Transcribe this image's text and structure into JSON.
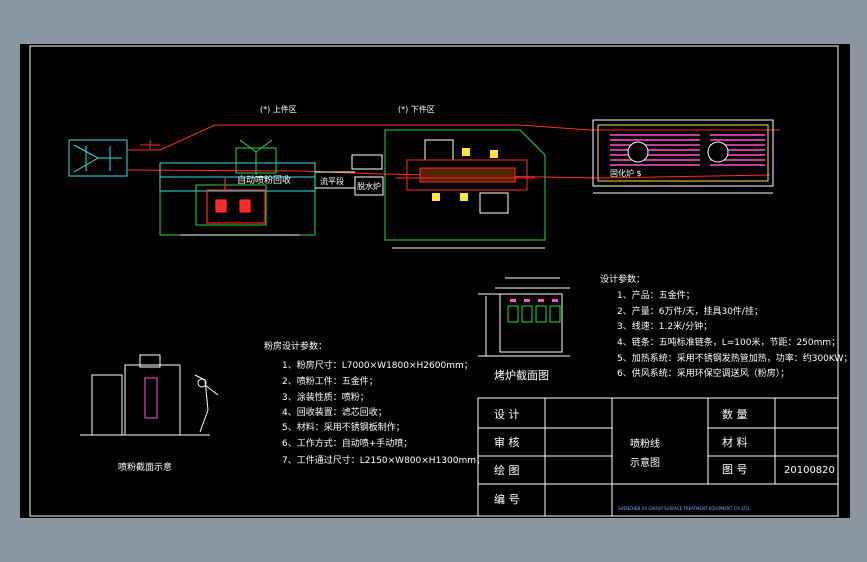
{
  "colors": {
    "background": "#8d97a3",
    "sheet": "#000000",
    "line_white": "#ffffff",
    "line_red": "#ff2a2a",
    "line_green": "#2bd63a",
    "line_cyan": "#35e0e6",
    "line_magenta": "#ff4fd0",
    "line_yellow": "#ffe43a"
  },
  "plan": {
    "upper_zone": "(*) 上件区",
    "lower_zone": "(*) 下件区",
    "booth_label": "自动喷粉回收",
    "leveling": "流平段",
    "degrease": "脱水炉",
    "dryer_label": "固化炉 $"
  },
  "oven_section": {
    "title": "烤炉截面图"
  },
  "booth_section": {
    "title": "喷粉截面示意"
  },
  "booth_params": {
    "heading": "粉房设计参数：",
    "items": [
      "1、粉房尺寸：L7000×W1800×H2600mm；",
      "2、喷粉工件：五金件；",
      "3、涂装性质：喷粉；",
      "4、回收装置：滤芯回收；",
      "5、材料：采用不锈钢板制作；",
      "6、工作方式：自动喷+手动喷；",
      "7、工件通过尺寸：L2150×W800×H1300mm；"
    ]
  },
  "design_params": {
    "heading": "设计参数：",
    "items": [
      "1、产品：五金件；",
      "2、产量：6万件/天，挂具30件/挂；",
      "3、线速：1.2米/分钟；",
      "4、链条：五吨标准链条，L=100米，节距：250mm；",
      "5、加热系统：采用不锈钢发热管加热，功率：约300KW；",
      "6、供风系统：采用环保空调送风（粉房）；"
    ]
  },
  "title_block": {
    "design": "设  计",
    "review": "审  核",
    "draw": "绘  图",
    "number": "编  号",
    "drawing_title_1": "喷粉线",
    "drawing_title_2": "示意图",
    "qty": "数  量",
    "material": "材  料",
    "drawing_no": "图  号",
    "drawing_no_value": "20100820",
    "company": "SHENZHEN XX GROUP SURFACE TREATMENT EQUIPMENT CO.,LTD."
  }
}
